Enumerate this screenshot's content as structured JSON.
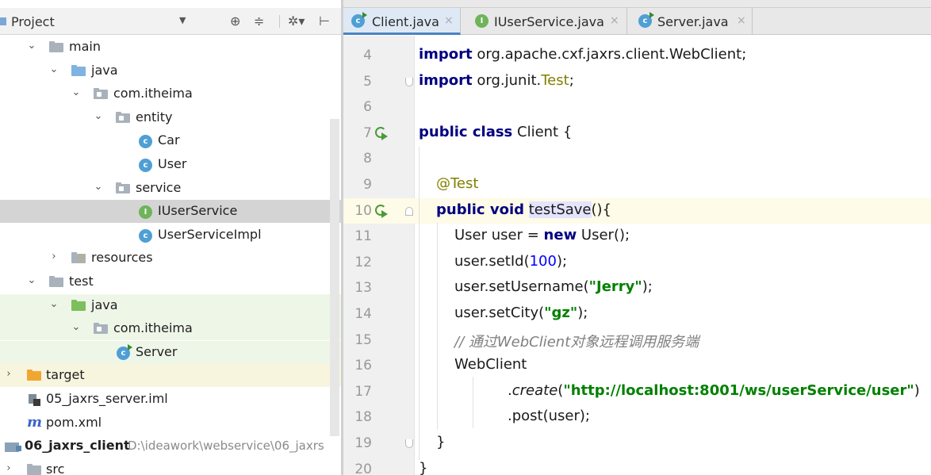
{
  "project_panel": {
    "title": "Project",
    "tree": [
      {
        "label": "main",
        "path": ""
      },
      {
        "label": "java",
        "path": ""
      },
      {
        "label": "com.itheima",
        "path": ""
      },
      {
        "label": "entity",
        "path": ""
      },
      {
        "label": "Car",
        "path": ""
      },
      {
        "label": "User",
        "path": ""
      },
      {
        "label": "service",
        "path": ""
      },
      {
        "label": "IUserService",
        "path": ""
      },
      {
        "label": "UserServiceImpl",
        "path": ""
      },
      {
        "label": "resources",
        "path": ""
      },
      {
        "label": "test",
        "path": ""
      },
      {
        "label": "java",
        "path": ""
      },
      {
        "label": "com.itheima",
        "path": ""
      },
      {
        "label": "Server",
        "path": ""
      },
      {
        "label": "target",
        "path": ""
      },
      {
        "label": "05_jaxrs_server.iml",
        "path": ""
      },
      {
        "label": "pom.xml",
        "path": ""
      },
      {
        "label": "06_jaxrs_client",
        "path": "D:\\ideawork\\webservice\\06_jaxrs"
      },
      {
        "label": "src",
        "path": ""
      }
    ],
    "selected_item": "IUserService"
  },
  "editor": {
    "tabs": [
      {
        "label": "Client.java",
        "active": true,
        "icon": "class-run-icon"
      },
      {
        "label": "IUserService.java",
        "active": false,
        "icon": "interface-icon"
      },
      {
        "label": "Server.java",
        "active": false,
        "icon": "class-run-icon"
      }
    ],
    "current_line": 10,
    "lines": [
      {
        "n": "4"
      },
      {
        "n": "5"
      },
      {
        "n": "6"
      },
      {
        "n": "7"
      },
      {
        "n": "8"
      },
      {
        "n": "9"
      },
      {
        "n": "10"
      },
      {
        "n": "11"
      },
      {
        "n": "12"
      },
      {
        "n": "13"
      },
      {
        "n": "14"
      },
      {
        "n": "15"
      },
      {
        "n": "16"
      },
      {
        "n": "17"
      },
      {
        "n": "18"
      },
      {
        "n": "19"
      },
      {
        "n": "20"
      }
    ],
    "code": {
      "l4_kw": "import",
      "l4_rest": " org.apache.cxf.jaxrs.client.WebClient;",
      "l5_kw": "import",
      "l5_pre": " org.junit.",
      "l5_ann": "Test",
      "l5_post": ";",
      "l7_kw": "public class",
      "l7_rest": " Client {",
      "l9_ann": "@Test",
      "l10_kw": "public void",
      "l10_sp": " ",
      "l10_hl": "testSave",
      "l10_rest": "(){",
      "l11_pre": "User user = ",
      "l11_kw": "new",
      "l11_post": " User();",
      "l12_pre": "user.setId(",
      "l12_num": "100",
      "l12_post": ");",
      "l13_pre": "user.setUsername(",
      "l13_str": "\"Jerry\"",
      "l13_post": ");",
      "l14_pre": "user.setCity(",
      "l14_str": "\"gz\"",
      "l14_post": ");",
      "l15_cmt": "// 通过WebClient对象远程调用服务端",
      "l16_text": "WebClient",
      "l17_pre": ".",
      "l17_it": "create",
      "l17_open": "(",
      "l17_str": "\"http://localhost:8001/ws/userService/user\"",
      "l17_close": ")",
      "l18_text": ".post(user);",
      "l19_text": "}",
      "l20_text": "}"
    }
  },
  "colors": {
    "keyword": "#000080",
    "annotation": "#808000",
    "string": "#008000",
    "number": "#0000ff",
    "comment": "#808080",
    "current_line": "#fefbe8",
    "selection": "#d4d4d4"
  }
}
